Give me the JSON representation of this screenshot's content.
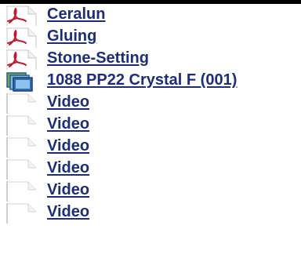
{
  "colors": {
    "link": "#1c2d7a",
    "top_bar": "#000000",
    "pdf_red": "#c4162a",
    "doc_gray": "#9a9a9a"
  },
  "items": [
    {
      "label": "Ceralun",
      "icon": "pdf-icon"
    },
    {
      "label": "Gluing",
      "icon": "pdf-icon"
    },
    {
      "label": "Stone-Setting",
      "icon": "pdf-icon"
    },
    {
      "label": "1088 PP22 Crystal F (001)",
      "icon": "image-gallery-icon"
    },
    {
      "label": "Video",
      "icon": "blank-document-icon"
    },
    {
      "label": "Video",
      "icon": "blank-document-icon"
    },
    {
      "label": "Video",
      "icon": "blank-document-icon"
    },
    {
      "label": "Video",
      "icon": "blank-document-icon"
    },
    {
      "label": "Video",
      "icon": "blank-document-icon"
    },
    {
      "label": "Video",
      "icon": "blank-document-icon"
    }
  ]
}
